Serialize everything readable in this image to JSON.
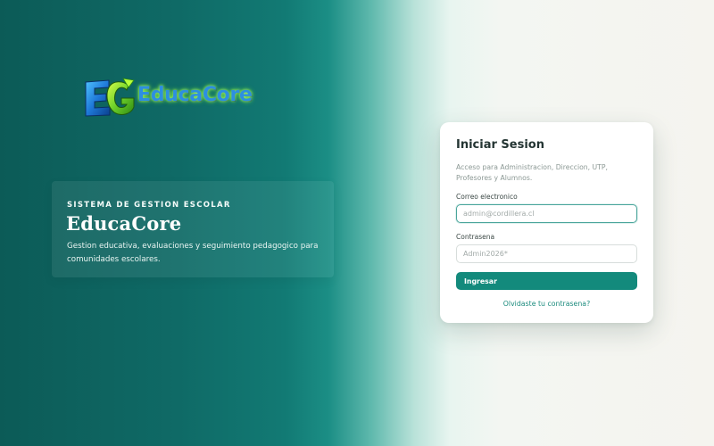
{
  "logo": {
    "mark_letters": "EG",
    "wordmark": "EducaCore"
  },
  "hero": {
    "kicker": "SISTEMA DE GESTION ESCOLAR",
    "title": "EducaCore",
    "description": "Gestion educativa, evaluaciones y seguimiento pedagogico para comunidades escolares."
  },
  "login": {
    "title": "Iniciar Sesion",
    "subtitle": "Acceso para Administracion, Direccion, UTP, Profesores y Alumnos.",
    "email": {
      "label": "Correo electronico",
      "placeholder": "admin@cordillera.cl",
      "value": ""
    },
    "password": {
      "label": "Contrasena",
      "placeholder": "Admin2026*",
      "value": ""
    },
    "submit_label": "Ingresar",
    "forgot_label": "Olvidaste tu contrasena?"
  },
  "colors": {
    "primary": "#138a7c",
    "teal_dark": "#0c5b57",
    "focus_border": "#4aa59b",
    "card_bg": "#ffffff"
  }
}
